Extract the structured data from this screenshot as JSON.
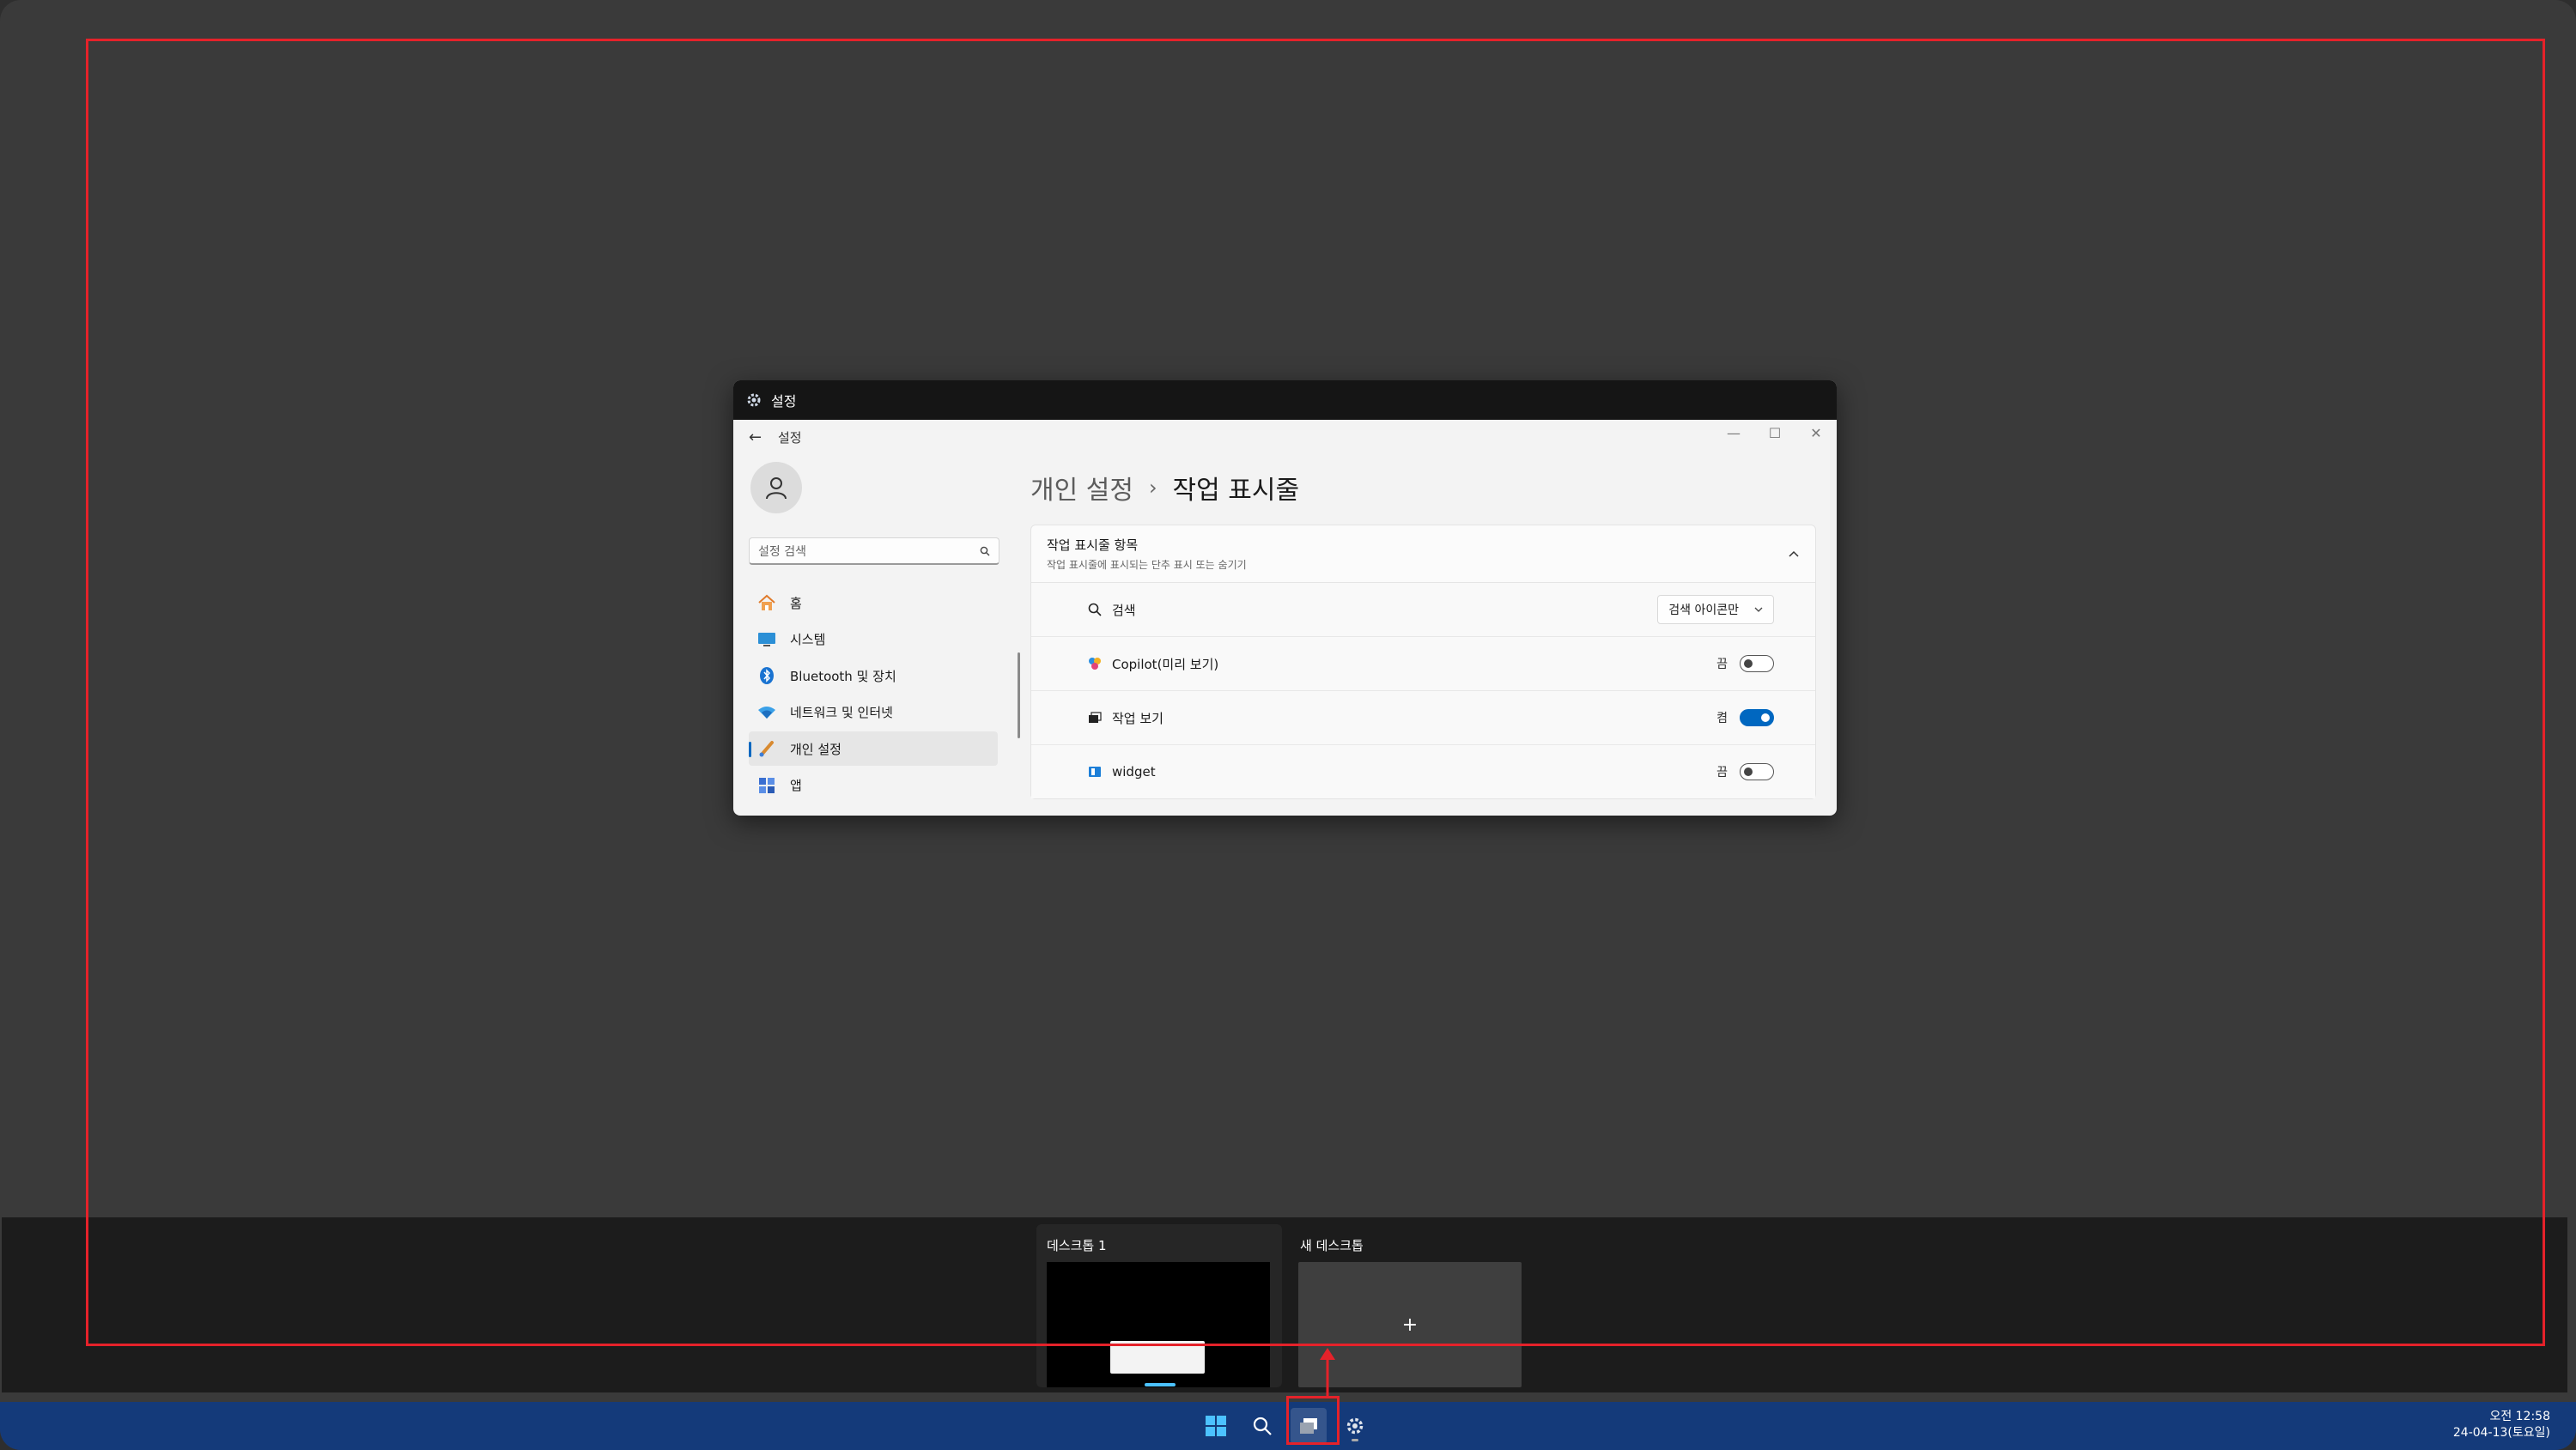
{
  "window": {
    "caption_title": "설정",
    "app_title": "설정",
    "caption_buttons": {
      "minimize": "—",
      "maximize": "☐",
      "close": "✕"
    }
  },
  "sidebar": {
    "search_placeholder": "설정 검색",
    "items": [
      {
        "label": "홈",
        "icon": "home-icon"
      },
      {
        "label": "시스템",
        "icon": "monitor-icon"
      },
      {
        "label": "Bluetooth 및 장치",
        "icon": "bluetooth-icon"
      },
      {
        "label": "네트워크 및 인터넷",
        "icon": "wifi-icon"
      },
      {
        "label": "개인 설정",
        "icon": "brush-icon",
        "active": true
      },
      {
        "label": "앱",
        "icon": "apps-icon"
      }
    ]
  },
  "content": {
    "breadcrumb_parent": "개인 설정",
    "breadcrumb_separator": "›",
    "page_title": "작업 표시줄",
    "section": {
      "title": "작업 표시줄 항목",
      "subtitle": "작업 표시줄에 표시되는 단추 표시 또는 숨기기"
    },
    "rows": {
      "search": {
        "label": "검색",
        "dropdown_value": "검색 아이콘만"
      },
      "copilot": {
        "label": "Copilot(미리 보기)",
        "state_label": "끔",
        "on": false
      },
      "taskview": {
        "label": "작업 보기",
        "state_label": "켬",
        "on": true
      },
      "widget": {
        "label": "widget",
        "state_label": "끔",
        "on": false
      }
    }
  },
  "virtual_desktops": {
    "desktop1_label": "데스크톱 1",
    "new_desktop_label": "새 데스크톱",
    "new_plus": "+"
  },
  "taskbar": {
    "clock_time": "오전 12:58",
    "clock_date": "24-04-13(토요일)"
  },
  "colors": {
    "accent": "#0067c0",
    "highlight": "#e5222a",
    "taskbar": "#143a7a",
    "indicator": "#4cc2ff"
  }
}
